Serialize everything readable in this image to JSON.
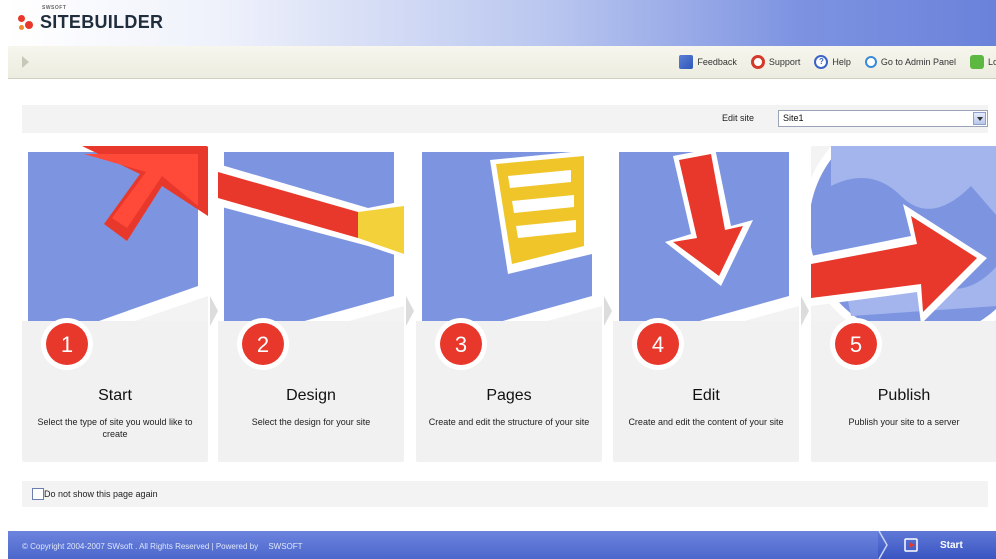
{
  "app": {
    "logo_small": "SWSOFT",
    "logo_text": "SITEBUILDER"
  },
  "toolbar": {
    "links": [
      {
        "label": "Feedback",
        "icon": "feedback-icon"
      },
      {
        "label": "Support",
        "icon": "support-icon"
      },
      {
        "label": "Help",
        "icon": "help-icon"
      },
      {
        "label": "Go to Admin Panel",
        "icon": "admin-panel-icon"
      },
      {
        "label": "Log out",
        "icon": "logout-icon"
      }
    ]
  },
  "edit_site": {
    "label": "Edit site",
    "value": "Site1"
  },
  "steps": [
    {
      "number": "1",
      "title": "Start",
      "description": "Select the type of site you would like to create"
    },
    {
      "number": "2",
      "title": "Design",
      "description": "Select the design for your site"
    },
    {
      "number": "3",
      "title": "Pages",
      "description": "Create and edit the structure of your site"
    },
    {
      "number": "4",
      "title": "Edit",
      "description": "Create and edit the content of your site"
    },
    {
      "number": "5",
      "title": "Publish",
      "description": "Publish your site to a server"
    }
  ],
  "options": {
    "dont_show_label": "Do not show this page again"
  },
  "footer": {
    "copyright": "© Copyright 2004-2007 SWsoft . All Rights Reserved | Powered by",
    "brand": "SWSOFT",
    "start_label": "Start"
  },
  "colors": {
    "accent_blue": "#6a82da",
    "step_red": "#e8372b",
    "card_bg": "#f1f1f1"
  }
}
